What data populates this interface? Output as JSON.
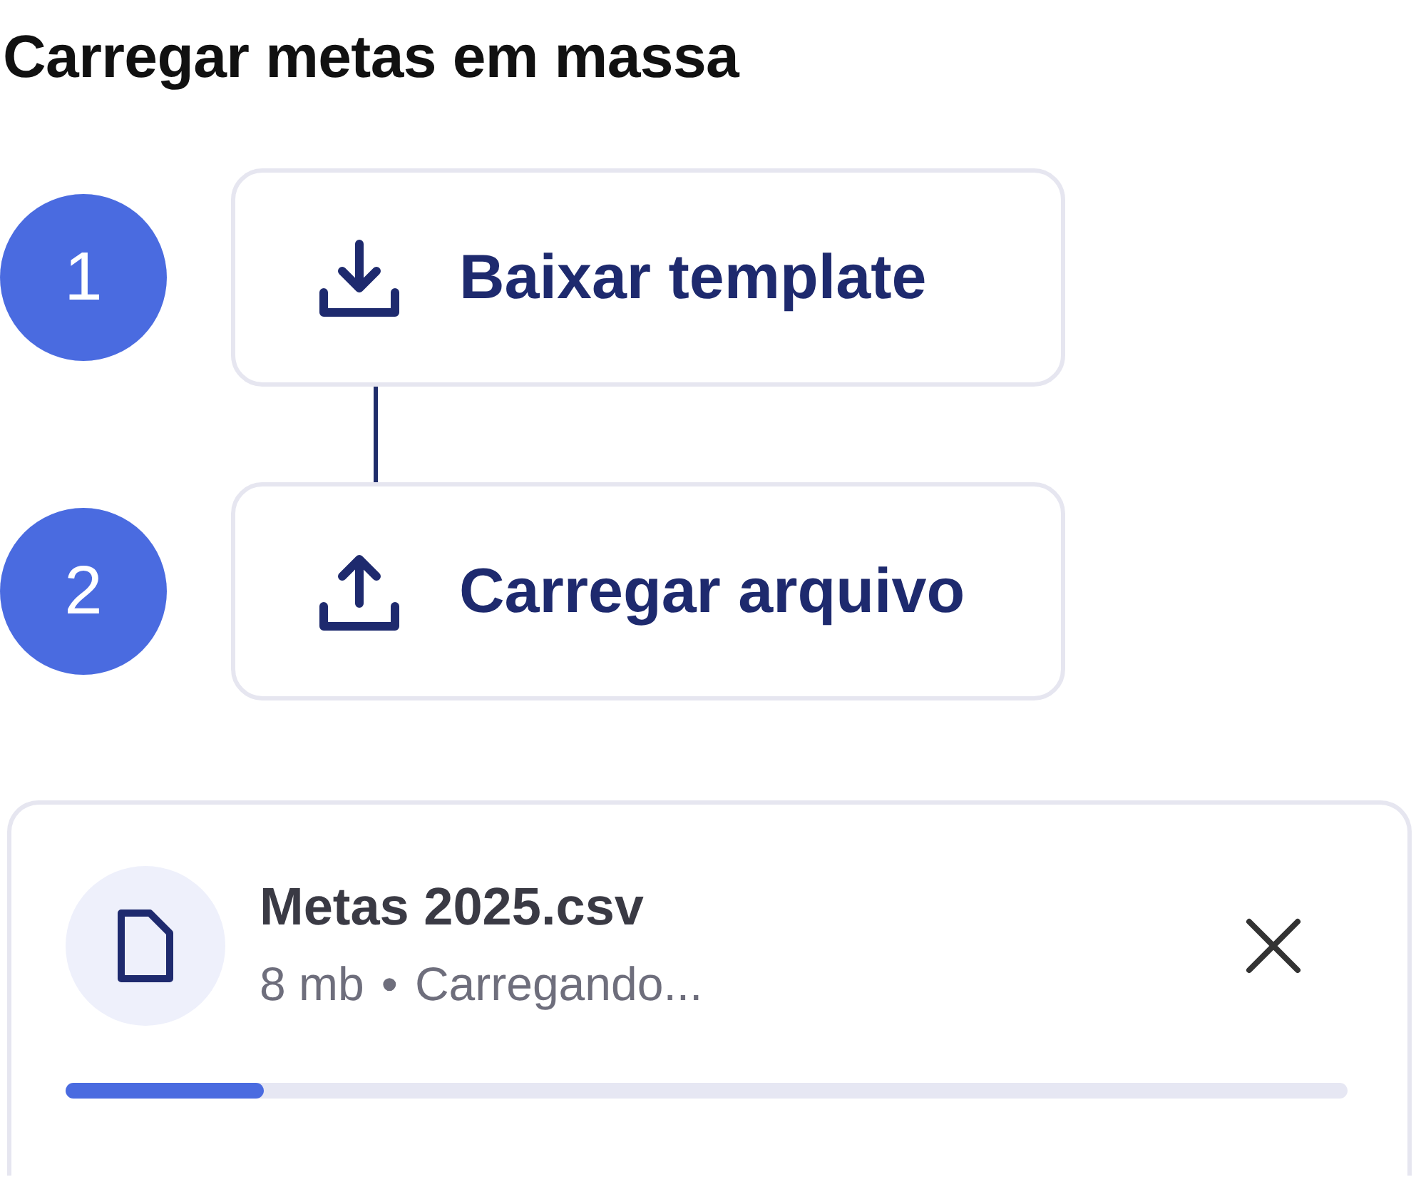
{
  "title": "Carregar metas em massa",
  "steps": [
    {
      "number": "1",
      "label": "Baixar template",
      "kind": "download"
    },
    {
      "number": "2",
      "label": "Carregar arquivo",
      "kind": "upload"
    }
  ],
  "file": {
    "name": "Metas 2025.csv",
    "size": "8 mb",
    "separator": "•",
    "status": "Carregando...",
    "level": 0.155
  }
}
